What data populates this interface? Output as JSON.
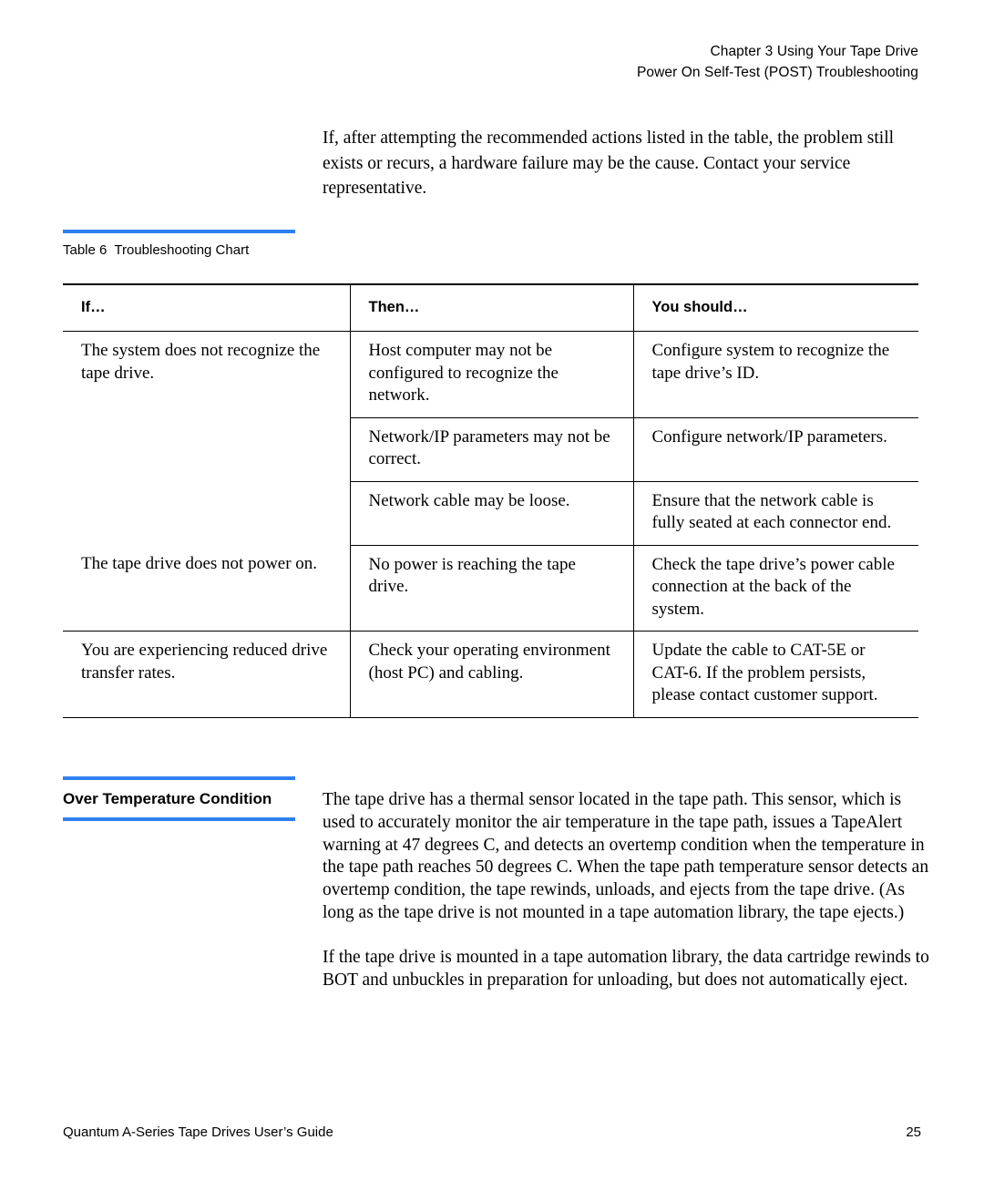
{
  "header": {
    "line1": "Chapter 3  Using Your Tape Drive",
    "line2": "Power On Self-Test (POST) Troubleshooting"
  },
  "intro": {
    "paragraph": "If, after attempting the recommended actions listed in the table, the problem still exists or recurs, a hardware failure may be the cause. Contact your service representative."
  },
  "table": {
    "caption_number": "Table 6",
    "caption_title": "Troubleshooting Chart",
    "rule_color": "#2f80ef",
    "columns": [
      "If…",
      "Then…",
      "You should…"
    ],
    "rows": [
      {
        "if": "The system does not recognize the tape drive.",
        "subrows": [
          {
            "then": "Host computer may not be configured to recognize the network.",
            "you_should": "Configure system to recognize the tape drive’s ID."
          },
          {
            "then": "Network/IP parameters may not be correct.",
            "you_should": "Configure network/IP parameters."
          },
          {
            "then": "Network cable may be loose.",
            "you_should": "Ensure that the network cable is fully seated at each connector end."
          }
        ]
      },
      {
        "if": "The tape drive does not power on.",
        "subrows": [
          {
            "then": "No power is reaching the tape drive.",
            "you_should": "Check the tape drive’s power cable connection at the back of the system."
          }
        ]
      },
      {
        "if": "You are experiencing reduced drive transfer rates.",
        "subrows": [
          {
            "then": "Check your operating environment (host PC) and cabling.",
            "you_should": "Update the cable to CAT-5E or CAT-6. If the problem persists, please contact customer support."
          }
        ]
      }
    ]
  },
  "section": {
    "heading": "Over Temperature Condition",
    "rule_color": "#2f80ef",
    "paragraphs": [
      "The tape drive has a thermal sensor located in the tape path. This sensor, which is used to accurately monitor the air temperature in the tape path, issues a TapeAlert warning at 47 degrees C, and detects an overtemp condition when the temperature in the tape path reaches 50 degrees C. When the tape path temperature sensor detects an overtemp condition, the tape rewinds, unloads, and ejects from the tape drive. (As long as the tape drive is not mounted in a tape automation library, the tape ejects.)",
      "If the tape drive is mounted in a tape automation library, the data cartridge rewinds to BOT and unbuckles in preparation for unloading, but does not automatically eject."
    ]
  },
  "footer": {
    "title": "Quantum A-Series Tape Drives User’s Guide",
    "page_number": "25"
  }
}
